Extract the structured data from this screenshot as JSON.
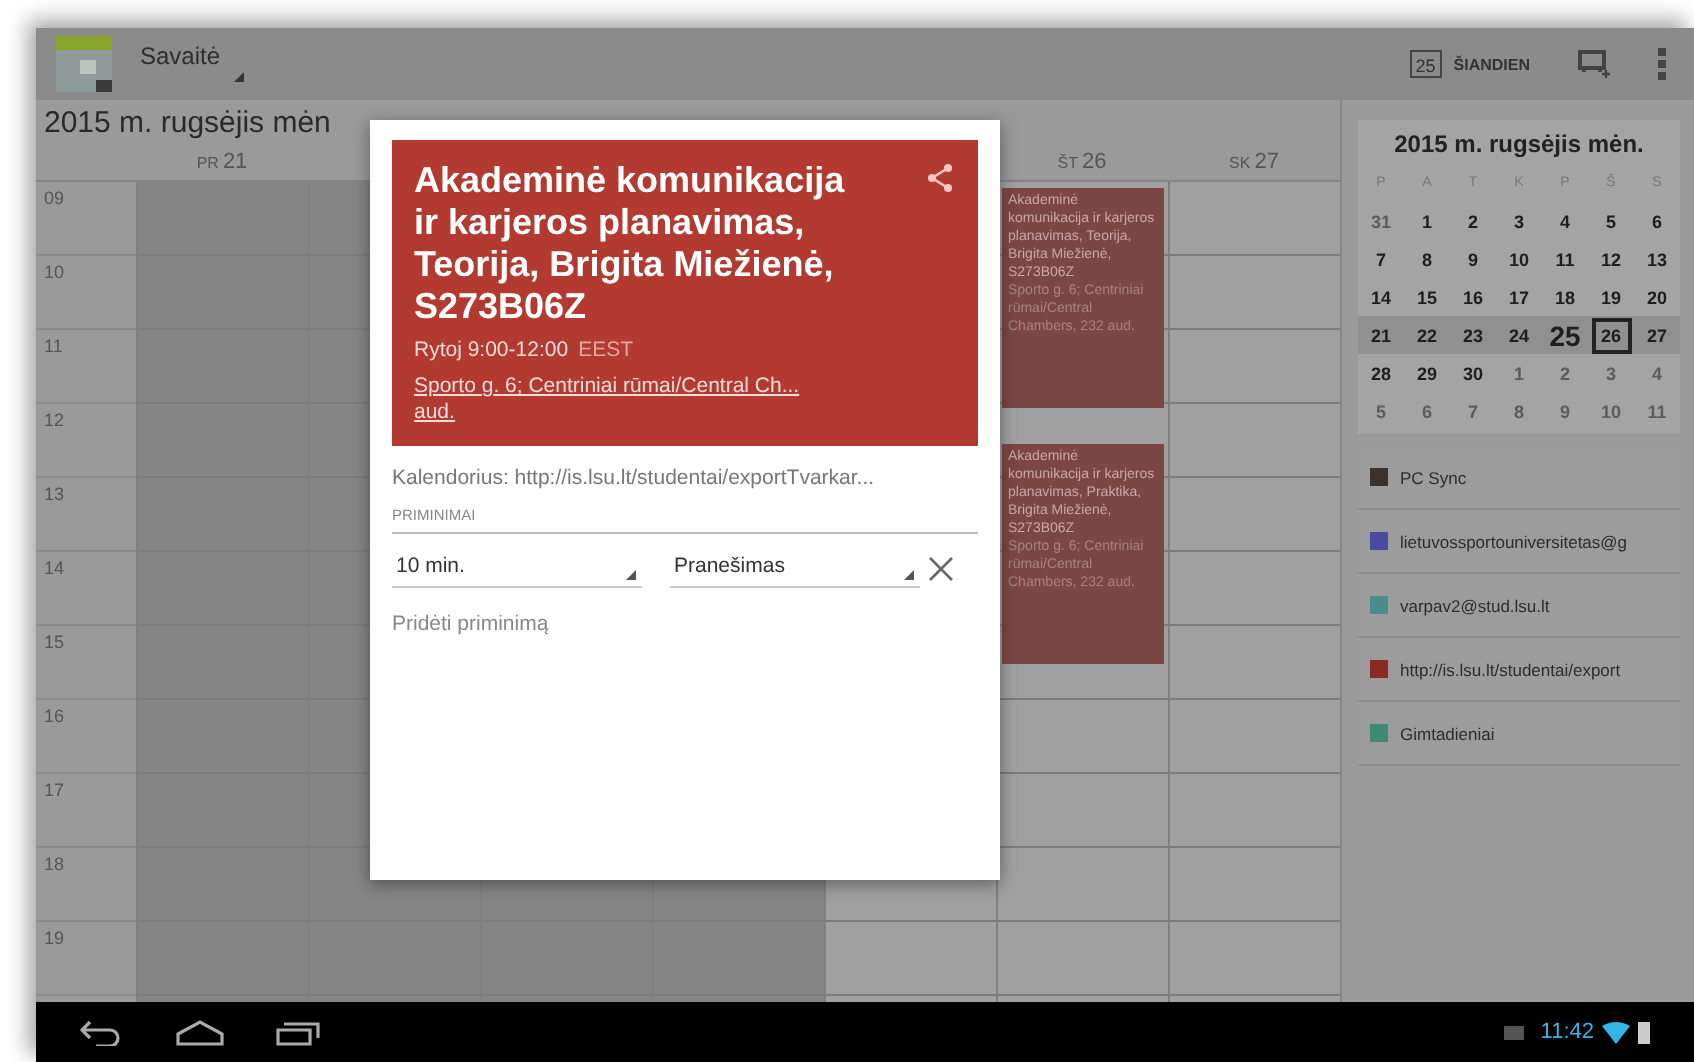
{
  "action_bar": {
    "view": "Savaitė",
    "today_icon_day": "25",
    "today_button": "ŠIANDIEN"
  },
  "month_title": "2015 m. rugsėjis mėn",
  "days": [
    {
      "weekday": "PR",
      "day": "21",
      "past": true
    },
    {
      "past": true
    },
    {
      "past": true
    },
    {
      "past": true
    },
    {
      "past": false
    },
    {
      "weekday": "ŠT",
      "day": "26",
      "past": false,
      "events": [
        {
          "title": "Akademinė komunikacija ir karjeros planavimas, Teorija, Brigita Miežienė, S273B06Z",
          "location": "Sporto g. 6; Centriniai rūmai/Central Chambers, 232  aud."
        },
        {
          "title": "Akademinė komunikacija ir karjeros planavimas, Praktika, Brigita Miežienė, S273B06Z",
          "location": "Sporto g. 6; Centriniai rūmai/Central Chambers, 232  aud."
        }
      ]
    },
    {
      "weekday": "SK",
      "day": "27",
      "past": false
    }
  ],
  "hours": [
    "09",
    "10",
    "11",
    "12",
    "13",
    "14",
    "15",
    "16",
    "17",
    "18",
    "19"
  ],
  "mini_calendar": {
    "title": "2015 m. rugsėjis mėn.",
    "weekdays": [
      "P",
      "A",
      "T",
      "K",
      "P",
      "Š",
      "S"
    ],
    "weeks": [
      {
        "highlighted": false,
        "days": [
          {
            "n": "31",
            "in_month": false,
            "today": false,
            "selected": false
          },
          {
            "n": "1",
            "in_month": true,
            "today": false,
            "selected": false
          },
          {
            "n": "2",
            "in_month": true,
            "today": false,
            "selected": false
          },
          {
            "n": "3",
            "in_month": true,
            "today": false,
            "selected": false
          },
          {
            "n": "4",
            "in_month": true,
            "today": false,
            "selected": false
          },
          {
            "n": "5",
            "in_month": true,
            "today": false,
            "selected": false
          },
          {
            "n": "6",
            "in_month": true,
            "today": false,
            "selected": false
          }
        ]
      },
      {
        "highlighted": false,
        "days": [
          {
            "n": "7",
            "in_month": true,
            "today": false,
            "selected": false
          },
          {
            "n": "8",
            "in_month": true,
            "today": false,
            "selected": false
          },
          {
            "n": "9",
            "in_month": true,
            "today": false,
            "selected": false
          },
          {
            "n": "10",
            "in_month": true,
            "today": false,
            "selected": false
          },
          {
            "n": "11",
            "in_month": true,
            "today": false,
            "selected": false
          },
          {
            "n": "12",
            "in_month": true,
            "today": false,
            "selected": false
          },
          {
            "n": "13",
            "in_month": true,
            "today": false,
            "selected": false
          }
        ]
      },
      {
        "highlighted": false,
        "days": [
          {
            "n": "14",
            "in_month": true,
            "today": false,
            "selected": false
          },
          {
            "n": "15",
            "in_month": true,
            "today": false,
            "selected": false
          },
          {
            "n": "16",
            "in_month": true,
            "today": false,
            "selected": false
          },
          {
            "n": "17",
            "in_month": true,
            "today": false,
            "selected": false
          },
          {
            "n": "18",
            "in_month": true,
            "today": false,
            "selected": false
          },
          {
            "n": "19",
            "in_month": true,
            "today": false,
            "selected": false
          },
          {
            "n": "20",
            "in_month": true,
            "today": false,
            "selected": false
          }
        ]
      },
      {
        "highlighted": true,
        "days": [
          {
            "n": "21",
            "in_month": true,
            "today": false,
            "selected": false
          },
          {
            "n": "22",
            "in_month": true,
            "today": false,
            "selected": false
          },
          {
            "n": "23",
            "in_month": true,
            "today": false,
            "selected": false
          },
          {
            "n": "24",
            "in_month": true,
            "today": false,
            "selected": false
          },
          {
            "n": "25",
            "in_month": true,
            "today": true,
            "selected": false
          },
          {
            "n": "26",
            "in_month": true,
            "today": false,
            "selected": true
          },
          {
            "n": "27",
            "in_month": true,
            "today": false,
            "selected": false
          }
        ]
      },
      {
        "highlighted": false,
        "days": [
          {
            "n": "28",
            "in_month": true,
            "today": false,
            "selected": false
          },
          {
            "n": "29",
            "in_month": true,
            "today": false,
            "selected": false
          },
          {
            "n": "30",
            "in_month": true,
            "today": false,
            "selected": false
          },
          {
            "n": "1",
            "in_month": false,
            "today": false,
            "selected": false
          },
          {
            "n": "2",
            "in_month": false,
            "today": false,
            "selected": false
          },
          {
            "n": "3",
            "in_month": false,
            "today": false,
            "selected": false
          },
          {
            "n": "4",
            "in_month": false,
            "today": false,
            "selected": false
          }
        ]
      },
      {
        "highlighted": false,
        "days": [
          {
            "n": "5",
            "in_month": false,
            "today": false,
            "selected": false
          },
          {
            "n": "6",
            "in_month": false,
            "today": false,
            "selected": false
          },
          {
            "n": "7",
            "in_month": false,
            "today": false,
            "selected": false
          },
          {
            "n": "8",
            "in_month": false,
            "today": false,
            "selected": false
          },
          {
            "n": "9",
            "in_month": false,
            "today": false,
            "selected": false
          },
          {
            "n": "10",
            "in_month": false,
            "today": false,
            "selected": false
          },
          {
            "n": "11",
            "in_month": false,
            "today": false,
            "selected": false
          }
        ]
      }
    ]
  },
  "calendars": [
    {
      "name": "PC Sync",
      "color": "#3a302c"
    },
    {
      "name": "lietuvossportouniversitetas@g",
      "color": "#4a4aa0"
    },
    {
      "name": "varpav2@stud.lsu.lt",
      "color": "#4a8c8a"
    },
    {
      "name": "http://is.lsu.lt/studentai/export",
      "color": "#8a2a26"
    },
    {
      "name": "Gimtadieniai",
      "color": "#3f8a72"
    }
  ],
  "dialog": {
    "title": "Akademinė komunikacija ir karjeros planavimas, Teorija, Brigita Miežienė, S273B06Z",
    "time": "Rytoj 9:00-12:00",
    "timezone": "EEST",
    "location_lines": [
      "Sporto g. 6; Centriniai rūmai/Central Ch...",
      "aud."
    ],
    "calendar": "Kalendorius: http://is.lsu.lt/studentai/exportTvarkar...",
    "reminders_label": "PRIMINIMAI",
    "reminders": [
      {
        "time": "10 min.",
        "method": "Pranešimas"
      }
    ],
    "add_reminder": "Pridėti priminimą"
  },
  "status_bar": {
    "time": "11:42"
  }
}
